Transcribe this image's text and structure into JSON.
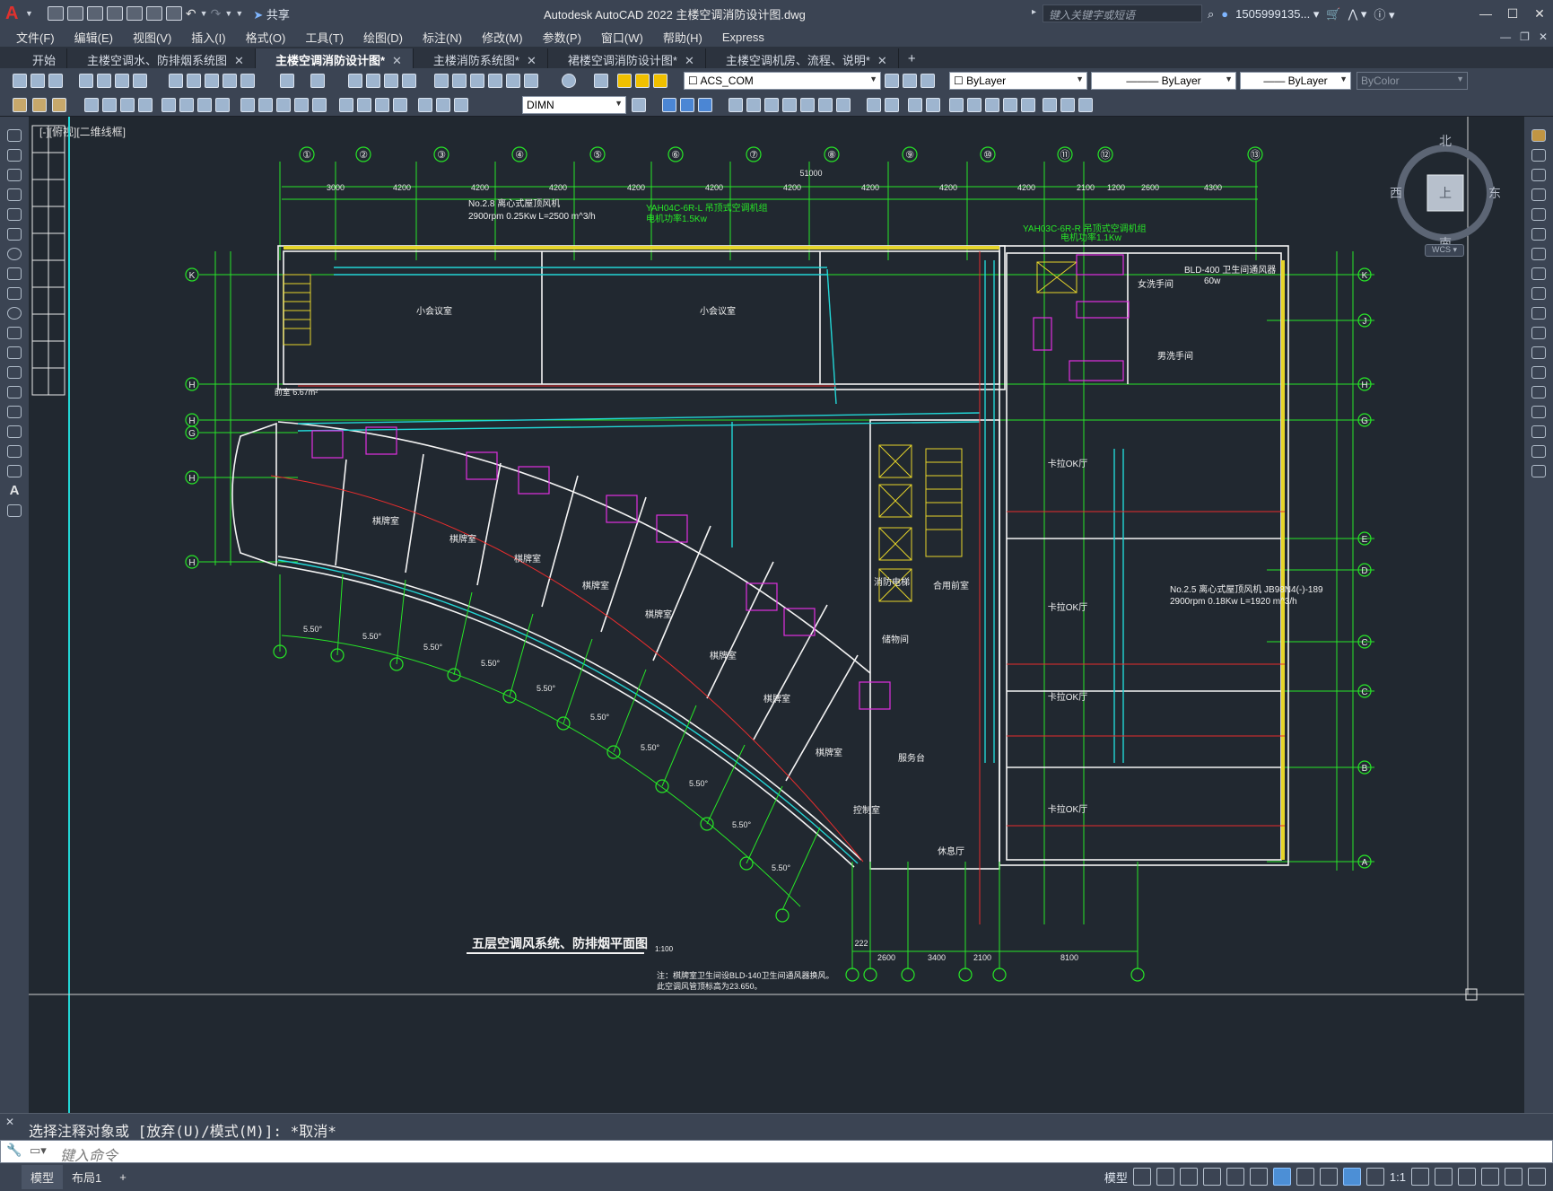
{
  "app": {
    "title": "Autodesk AutoCAD 2022    主楼空调消防设计图.dwg",
    "share": "共享",
    "search_placeholder": "键入关键字或短语",
    "user": "1505999135... ▾"
  },
  "menu": [
    "文件(F)",
    "编辑(E)",
    "视图(V)",
    "插入(I)",
    "格式(O)",
    "工具(T)",
    "绘图(D)",
    "标注(N)",
    "修改(M)",
    "参数(P)",
    "窗口(W)",
    "帮助(H)",
    "Express"
  ],
  "tabs": [
    {
      "label": "开始",
      "active": false,
      "close": false
    },
    {
      "label": "主楼空调水、防排烟系统图",
      "active": false,
      "close": true
    },
    {
      "label": "主楼空调消防设计图*",
      "active": true,
      "close": true
    },
    {
      "label": "主楼消防系统图*",
      "active": false,
      "close": true
    },
    {
      "label": "裙楼空调消防设计图*",
      "active": false,
      "close": true
    },
    {
      "label": "主楼空调机房、流程、说明*",
      "active": false,
      "close": true
    }
  ],
  "toolbar": {
    "layer": "ACS_COM",
    "color": "ByLayer",
    "linetype": "ByLayer",
    "lineweight": "ByLayer",
    "plotstyle": "ByColor",
    "dimstyle": "DIMN"
  },
  "viewport_label": "[-][俯视][二维线框]",
  "viewcube": {
    "north": "北",
    "south": "南",
    "east": "东",
    "west": "西",
    "top": "上",
    "wcs": "WCS ▾"
  },
  "drawing": {
    "title": "五层空调风系统、防排烟平面图",
    "scale": "1:100",
    "note1": "注：棋牌室卫生间设BLD-140卫生间通风器换风。",
    "note2": "此空调风管顶标高为23.650。",
    "axes_top": [
      "①",
      "②",
      "③",
      "④",
      "⑤",
      "⑥",
      "⑦",
      "⑧",
      "⑨",
      "⑩",
      "⑪",
      "⑫",
      "⑬"
    ],
    "dims_top": [
      "3000",
      "4200",
      "4200",
      "4200",
      "4200",
      "4200",
      "4200",
      "4200",
      "4200",
      "4200",
      "2100",
      "1200",
      "2600",
      "4300"
    ],
    "total_dim": "51000",
    "rows_left": [
      "K",
      "H",
      "H",
      "G",
      "H",
      "H"
    ],
    "rows_right": [
      "K",
      "J",
      "H",
      "G",
      "E",
      "D",
      "C",
      "C",
      "B",
      "A"
    ],
    "room_labels": [
      "小会议室",
      "小会议室",
      "女洗手间",
      "男洗手间",
      "卡拉OK厅",
      "卡拉OK厅",
      "卡拉OK厅",
      "卡拉OK厅",
      "棋牌室",
      "棋牌室",
      "棋牌室",
      "棋牌室",
      "棋牌室",
      "棋牌室",
      "棋牌室",
      "棋牌室",
      "服务台",
      "控制室",
      "休息厅",
      "储物间",
      "消防电梯",
      "合用前室",
      "前室 6.67m²"
    ],
    "equip1": "No.2.8 离心式屋顶风机",
    "equip1b": "2900rpm 0.25Kw  L=2500 m^3/h",
    "equip2": "YAH04C-6R-L 吊顶式空调机组",
    "equip2b": "电机功率1.5Kw",
    "equip3": "YAH03C-6R-R 吊顶式空调机组",
    "equip3b": "电机功率1.1Kw",
    "equip4": "No.2.5 离心式屋顶风机 JB98N4(-)-189",
    "equip4b": "2900rpm 0.18Kw  L=1920 m^3/h",
    "equip5": "BLD-400 卫生间通风器",
    "equip5b": "60w",
    "angle": "5.50°",
    "bottom_dims": [
      "222",
      "2600",
      "3400",
      "2100",
      "8100"
    ]
  },
  "command": {
    "history": "选择注释对象或 [放弃(U)/模式(M)]: *取消*",
    "placeholder": "键入命令"
  },
  "status": {
    "model_tab": "模型",
    "layout_tab": "布局1",
    "model_btn": "模型",
    "scale": "1:1"
  }
}
